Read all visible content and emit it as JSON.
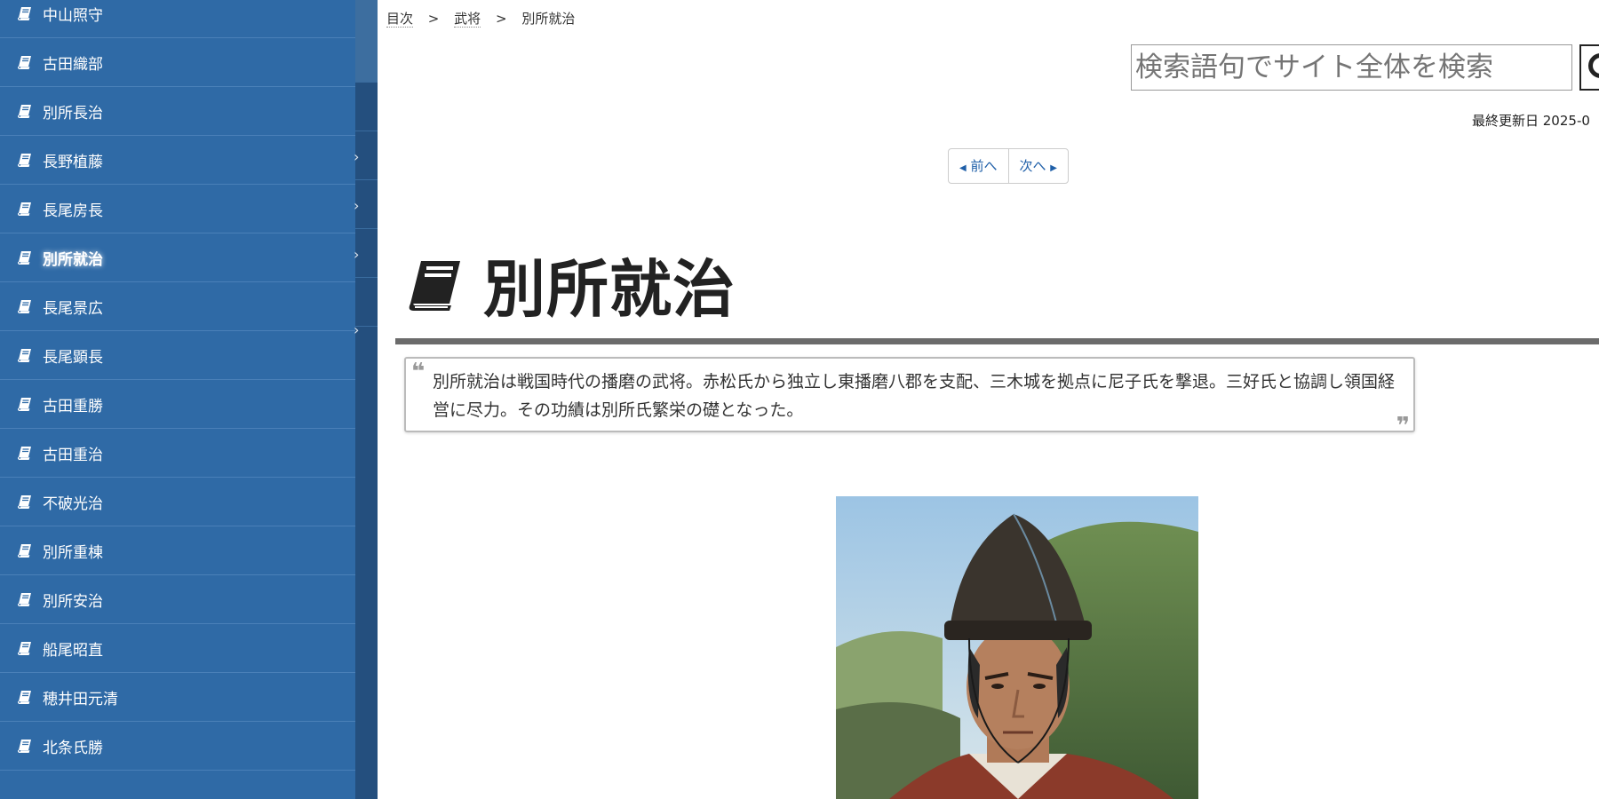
{
  "sidebar": {
    "items": [
      {
        "label": "中山照守",
        "active": false
      },
      {
        "label": "古田織部",
        "active": false
      },
      {
        "label": "別所長治",
        "active": false
      },
      {
        "label": "長野植藤",
        "active": false
      },
      {
        "label": "長尾房長",
        "active": false
      },
      {
        "label": "別所就治",
        "active": true
      },
      {
        "label": "長尾景広",
        "active": false
      },
      {
        "label": "長尾顕長",
        "active": false
      },
      {
        "label": "古田重勝",
        "active": false
      },
      {
        "label": "古田重治",
        "active": false
      },
      {
        "label": "不破光治",
        "active": false
      },
      {
        "label": "別所重棟",
        "active": false
      },
      {
        "label": "別所安治",
        "active": false
      },
      {
        "label": "船尾昭直",
        "active": false
      },
      {
        "label": "穂井田元清",
        "active": false
      },
      {
        "label": "北条氏勝",
        "active": false
      }
    ],
    "item_icon": "book-icon",
    "colors": {
      "bg": "#2f6aa6",
      "gutter": "#244f7e"
    }
  },
  "breadcrumb": {
    "items": [
      "目次",
      "武将",
      "別所就治"
    ],
    "separator": ">"
  },
  "search": {
    "placeholder": "検索語句でサイト全体を検索",
    "button_icon": "search-icon"
  },
  "updated": {
    "text": "最終更新日 2025-0"
  },
  "pager": {
    "prev_label": "前へ",
    "next_label": "次へ"
  },
  "page": {
    "title": "別所就治",
    "title_icon": "book-icon",
    "summary": "別所就治は戦国時代の播磨の武将。赤松氏から独立し東播磨八郡を支配、三木城を拠点に尼子氏を撃退。三好氏と協調し領国経営に尽力。その功績は別所氏繁栄の礎となった。",
    "quote_open": "❝",
    "quote_close": "❞",
    "image": "portrait-photo"
  }
}
